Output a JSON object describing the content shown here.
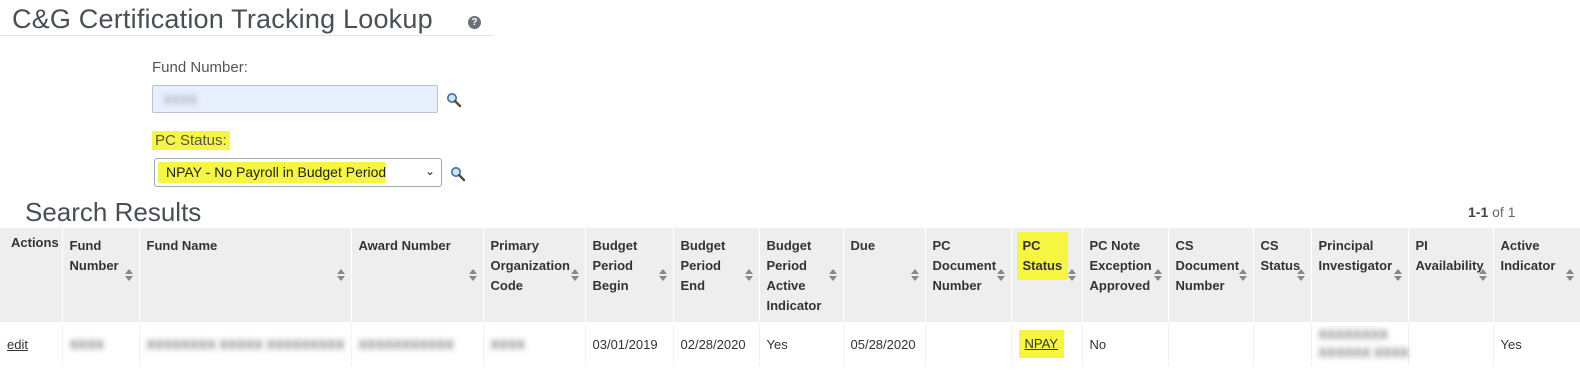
{
  "page": {
    "title": "C&G Certification Tracking Lookup",
    "help_icon": "question-circle-icon"
  },
  "criteria": {
    "fund_number_label": "Fund Number:",
    "fund_number_value": "XXXX",
    "pc_status_label": "PC Status:",
    "pc_status_selected": "NPAY - No Payroll in Budget Period",
    "lookup_icon": "magnifier-icon",
    "highlight_color": "#f5f542"
  },
  "results": {
    "title": "Search Results",
    "pager_range": "1-1",
    "pager_total": " of 1",
    "columns": [
      "Actions",
      "Fund Number",
      "Fund Name",
      "Award Number",
      "Primary Organization Code",
      "Budget Period Begin",
      "Budget Period End",
      "Budget Period Active Indicator",
      "Due",
      "PC Document Number",
      "PC Status",
      "PC Note Exception Approved",
      "CS Document Number",
      "CS Status",
      "Principal Investigator",
      "PI Availability",
      "Active Indicator"
    ],
    "rows": [
      {
        "action": "edit",
        "fund_number": "XXXX",
        "fund_name": "XXXXXXXX XXXXX XXXXXXXXX",
        "award_number": "XXXXXXXXXXX",
        "org_code": "XXXX",
        "budget_begin": "03/01/2019",
        "budget_end": "02/28/2020",
        "budget_active": "Yes",
        "due": "05/28/2020",
        "pc_document": "",
        "pc_status": "NPAY",
        "pc_note_exception": "No",
        "cs_document": "",
        "cs_status": "",
        "principal_investigator_line1": "XXXXXXXX",
        "principal_investigator_line2": "XXXXXX XXXX",
        "pi_availability": "",
        "active_indicator": "Yes"
      }
    ]
  }
}
